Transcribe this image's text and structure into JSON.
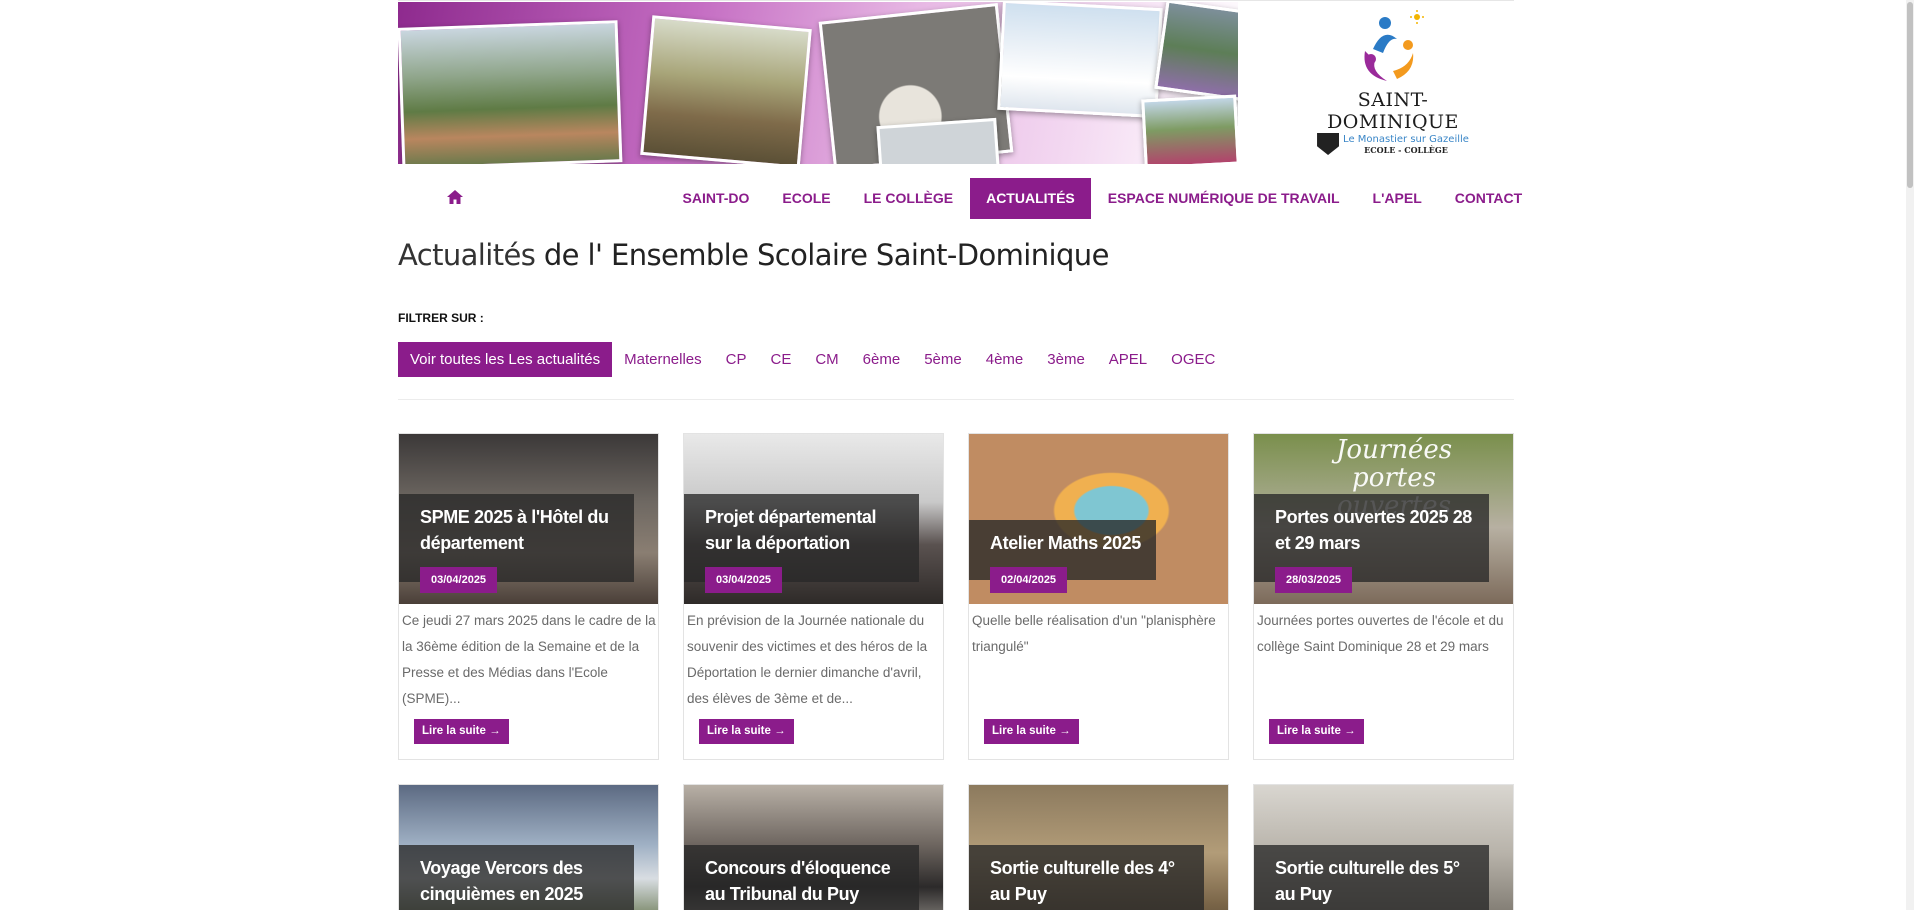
{
  "brand": {
    "name": "SAINT-DOMINIQUE",
    "place": "Le Monastier sur Gazeille",
    "kind": "ECOLE - COLLÈGE"
  },
  "nav": {
    "items": [
      {
        "label": "SAINT-DO"
      },
      {
        "label": "ECOLE"
      },
      {
        "label": "LE COLLÈGE"
      },
      {
        "label": "ACTUALITÉS"
      },
      {
        "label": "ESPACE NUMÉRIQUE DE TRAVAIL"
      },
      {
        "label": "L'APEL"
      },
      {
        "label": "CONTACT"
      }
    ],
    "active": "ACTUALITÉS"
  },
  "title": {
    "light": "Actualités",
    "bold": "de l' Ensemble Scolaire Saint-Dominique"
  },
  "filter": {
    "label": "FILTRER SUR :",
    "options": [
      {
        "label": "Voir toutes les Les actualités"
      },
      {
        "label": "Maternelles"
      },
      {
        "label": "CP"
      },
      {
        "label": "CE"
      },
      {
        "label": "CM"
      },
      {
        "label": "6ème"
      },
      {
        "label": "5ème"
      },
      {
        "label": "4ème"
      },
      {
        "label": "3ème"
      },
      {
        "label": "APEL"
      },
      {
        "label": "OGEC"
      }
    ]
  },
  "articles": [
    {
      "title": "SPME 2025 à l'Hôtel du département",
      "date": "03/04/2025",
      "excerpt": "Ce jeudi 27 mars 2025 dans le cadre de la la 36ème édition de la Semaine et de la Presse et des Médias dans l'Ecole (SPME)...",
      "more": "Lire la suite →"
    },
    {
      "title": "Projet départemental sur la déportation",
      "date": "03/04/2025",
      "excerpt": "En prévision de la Journée nationale du souvenir des victimes et des héros de la Déportation le dernier dimanche d'avril, des élèves de 3ème et de...",
      "more": "Lire la suite →"
    },
    {
      "title": "Atelier Maths 2025",
      "date": "02/04/2025",
      "excerpt": "Quelle belle réalisation d'un \"planisphère triangulé\"",
      "more": "Lire la suite →"
    },
    {
      "title": "Portes ouvertes 2025 28 et 29 mars",
      "date": "28/03/2025",
      "excerpt": "Journées portes ouvertes de l'école et du collège Saint Dominique 28 et 29 mars",
      "more": "Lire la suite →",
      "image_text": "Journées portes ouvertes"
    },
    {
      "title": "Voyage Vercors des cinquièmes en 2025"
    },
    {
      "title": "Concours d'éloquence au Tribunal du Puy"
    },
    {
      "title": "Sortie culturelle des 4° au Puy"
    },
    {
      "title": "Sortie culturelle des 5° au Puy"
    }
  ],
  "colors": {
    "accent": "#8b1c8b",
    "overlay": "#282828",
    "text_muted": "#6a6a6a"
  }
}
